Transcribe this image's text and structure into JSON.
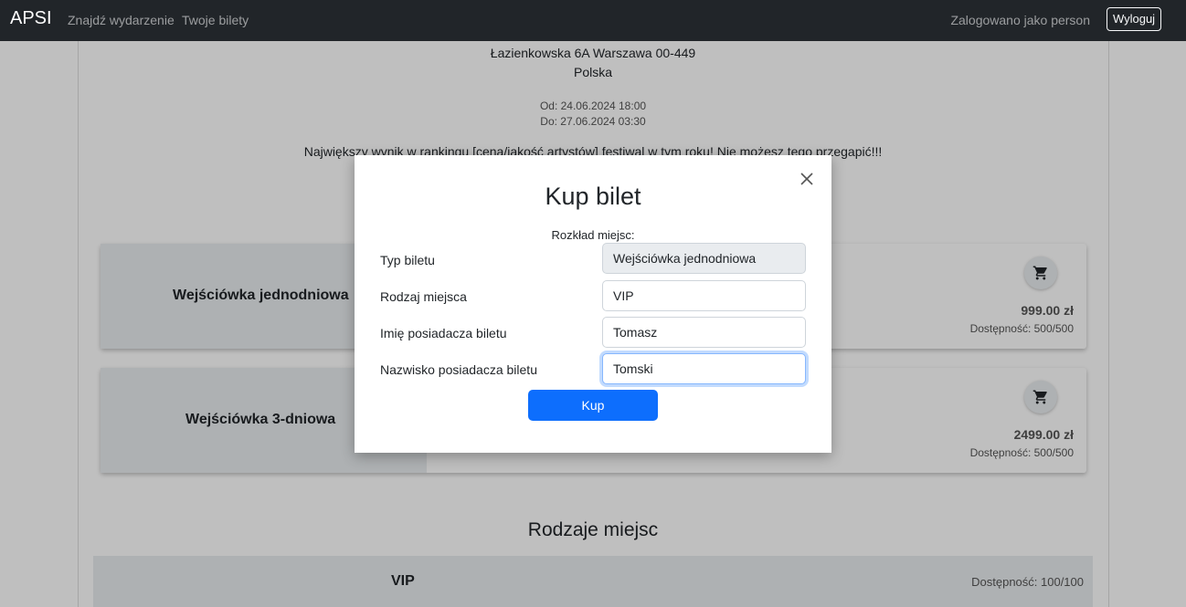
{
  "navbar": {
    "brand": "APSI",
    "links": [
      "Znajdź wydarzenie",
      "Twoje bilety"
    ],
    "user_text": "Zalogowano jako person",
    "logout_label": "Wyloguj"
  },
  "event": {
    "address": "Łazienkowska 6A Warszawa 00-449",
    "country": "Polska",
    "date_from": "Od: 24.06.2024 18:00",
    "date_to": "Do: 27.06.2024 03:30",
    "description": "Największy wynik w rankingu [cena/jakość artystów] festiwal w tym roku! Nie możesz tego przegapić!!!"
  },
  "tickets": [
    {
      "name": "Wejściówka jednodniowa",
      "price": "999.00 zł",
      "availability": "Dostępność: 500/500",
      "cart_icon": "cart-icon"
    },
    {
      "name": "Wejściówka 3-dniowa",
      "price": "2499.00 zł",
      "availability": "Dostępność: 500/500",
      "cart_icon": "cart-icon"
    }
  ],
  "seats_section": {
    "title": "Rodzaje miejsc",
    "items": [
      {
        "name": "VIP",
        "availability": "Dostępność: 100/100"
      }
    ]
  },
  "modal": {
    "title": "Kup bilet",
    "subtitle": "Rozkład miejsc:",
    "close_icon": "close-icon",
    "fields": [
      {
        "label": "Typ biletu",
        "value": "Wejściówka jednodniowa",
        "disabled": true
      },
      {
        "label": "Rodzaj miejsca",
        "value": "VIP"
      },
      {
        "label": "Imię posiadacza biletu",
        "value": "Tomasz"
      },
      {
        "label": "Nazwisko posiadacza biletu",
        "value": "Tomski",
        "focused": true
      }
    ],
    "buy_label": "Kup"
  },
  "colors": {
    "navbar": "#212529",
    "primary": "#0d6efd",
    "card_left": "#e9ecef"
  }
}
